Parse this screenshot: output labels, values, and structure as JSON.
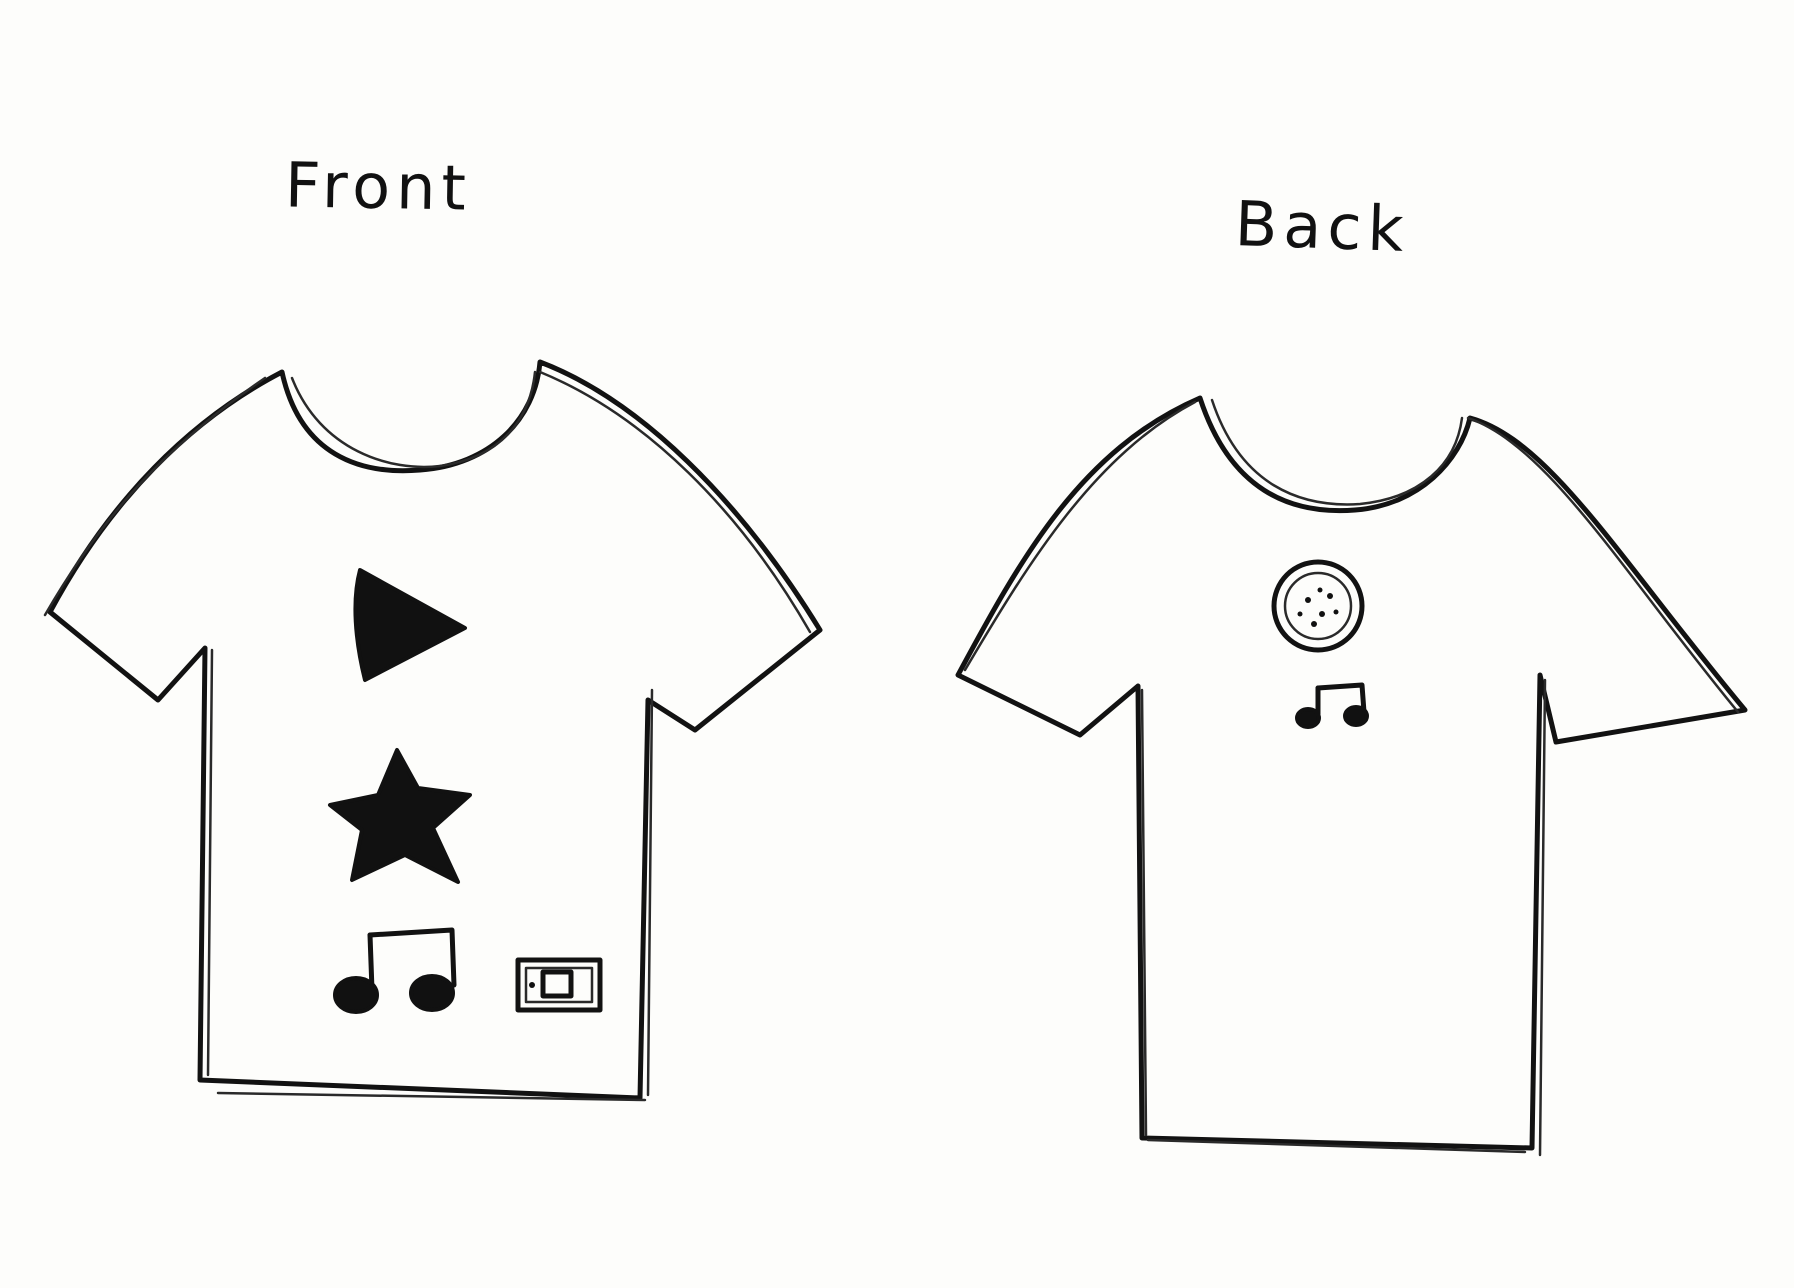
{
  "labels": {
    "front": "Front",
    "back": "Back"
  },
  "colors": {
    "ink": "#111111",
    "paper": "#fdfdfb"
  },
  "icons": {
    "front": [
      "play-triangle-icon",
      "star-icon",
      "music-note-icon",
      "ticket-icon"
    ],
    "back": [
      "cd-disc-icon",
      "music-note-icon"
    ]
  }
}
